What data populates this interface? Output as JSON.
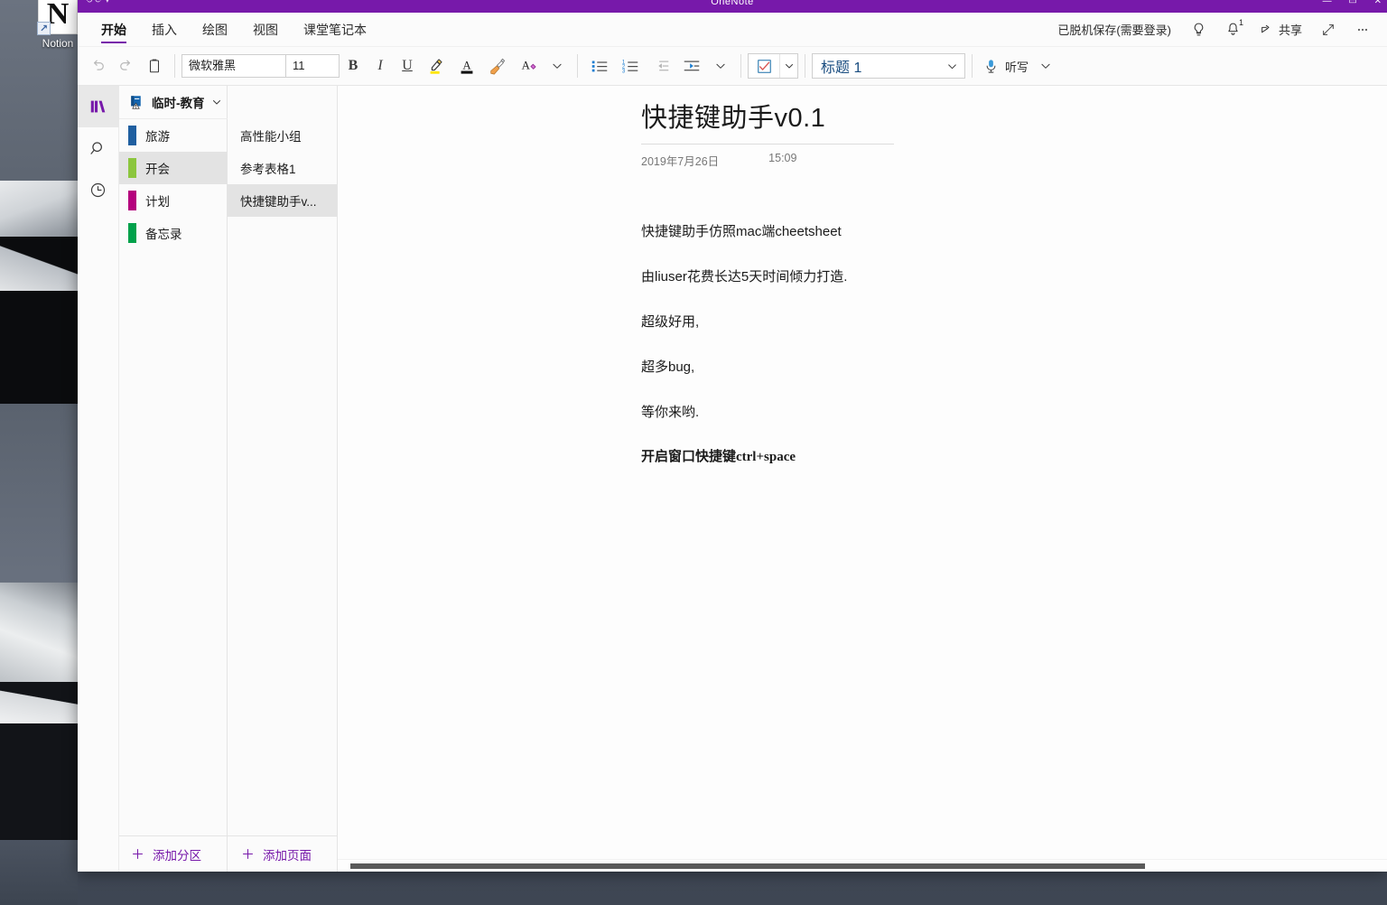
{
  "desktop": {
    "icon_label": "Notion",
    "icon_glyph": "N",
    "wallpaper": "grayscale-mountain-photo"
  },
  "window": {
    "title": "OneNote",
    "titlebar_color": "#7719aa"
  },
  "ribbon_tabs": [
    {
      "label": "开始",
      "active": true
    },
    {
      "label": "插入",
      "active": false
    },
    {
      "label": "绘图",
      "active": false
    },
    {
      "label": "视图",
      "active": false
    },
    {
      "label": "课堂笔记本",
      "active": false
    }
  ],
  "header_right": {
    "save_state": "已脱机保存(需要登录)",
    "tell_me_icon": "lightbulb-icon",
    "notifications_icon": "bell-icon",
    "notifications_count": "1",
    "share_label": "共享",
    "share_icon": "share-icon",
    "expand_icon": "expand-diagonal-icon",
    "overflow_icon": "ellipsis-icon"
  },
  "toolbar": {
    "undo_icon": "undo-icon",
    "redo_icon": "redo-icon",
    "paste_icon": "clipboard-icon",
    "font_name": "微软雅黑",
    "font_size": "11",
    "bold_label": "B",
    "italic_label": "I",
    "underline_label": "U",
    "highlight_icon": "highlighter-icon",
    "font_color_icon": "font-color-icon",
    "format_painter_icon": "format-painter-icon",
    "clear_formatting_icon": "clear-formatting-icon",
    "more_font_icon": "chevron-down-icon",
    "bullets_icon": "bullet-list-icon",
    "numbering_icon": "numbered-list-icon",
    "decrease_indent_icon": "decrease-indent-icon",
    "increase_indent_icon": "increase-indent-icon",
    "more_para_icon": "chevron-down-icon",
    "tag_icon": "todo-checkbox-icon",
    "tag_caret_icon": "chevron-down-icon",
    "style_value": "标题 1",
    "style_caret_icon": "chevron-down-icon",
    "dictate_label": "听写",
    "dictate_icon": "microphone-icon",
    "dictate_caret_icon": "chevron-down-icon"
  },
  "rail": [
    {
      "name": "notebooks",
      "icon": "notebooks-icon",
      "active": true
    },
    {
      "name": "search",
      "icon": "search-icon",
      "active": false
    },
    {
      "name": "recent",
      "icon": "clock-icon",
      "active": false
    }
  ],
  "notebook": {
    "name": "临时-教育",
    "icon": "notebook-warning-icon",
    "caret_icon": "chevron-down-icon"
  },
  "sections": [
    {
      "label": "旅游",
      "color": "#1f5fa0",
      "active": false
    },
    {
      "label": "开会",
      "color": "#8cc63e",
      "active": true
    },
    {
      "label": "计划",
      "color": "#b5007d",
      "active": false
    },
    {
      "label": "备忘录",
      "color": "#00a14b",
      "active": false
    }
  ],
  "add_section": {
    "label": "添加分区",
    "icon": "plus-icon"
  },
  "pages": [
    {
      "label": "高性能小组",
      "active": false
    },
    {
      "label": "参考表格1",
      "active": false
    },
    {
      "label": "快捷键助手v...",
      "active": true
    }
  ],
  "add_page": {
    "label": "添加页面",
    "icon": "plus-icon"
  },
  "document": {
    "title": "快捷键助手v0.1",
    "date": "2019年7月26日",
    "time": "15:09",
    "paragraphs": [
      {
        "text": "快捷键助手仿照mac端cheetsheet",
        "bold": false
      },
      {
        "text": "由liuser花费长达5天时间倾力打造.",
        "bold": false
      },
      {
        "text": "超级好用,",
        "bold": false
      },
      {
        "text": "超多bug,",
        "bold": false
      },
      {
        "text": "等你来哟.",
        "bold": false
      },
      {
        "text": "开启窗口快捷键ctrl+space",
        "bold": true
      }
    ]
  },
  "colors": {
    "accent_purple": "#7719aa",
    "selection_gray": "#e3e3e3",
    "app_background": "#fbfbfb"
  }
}
